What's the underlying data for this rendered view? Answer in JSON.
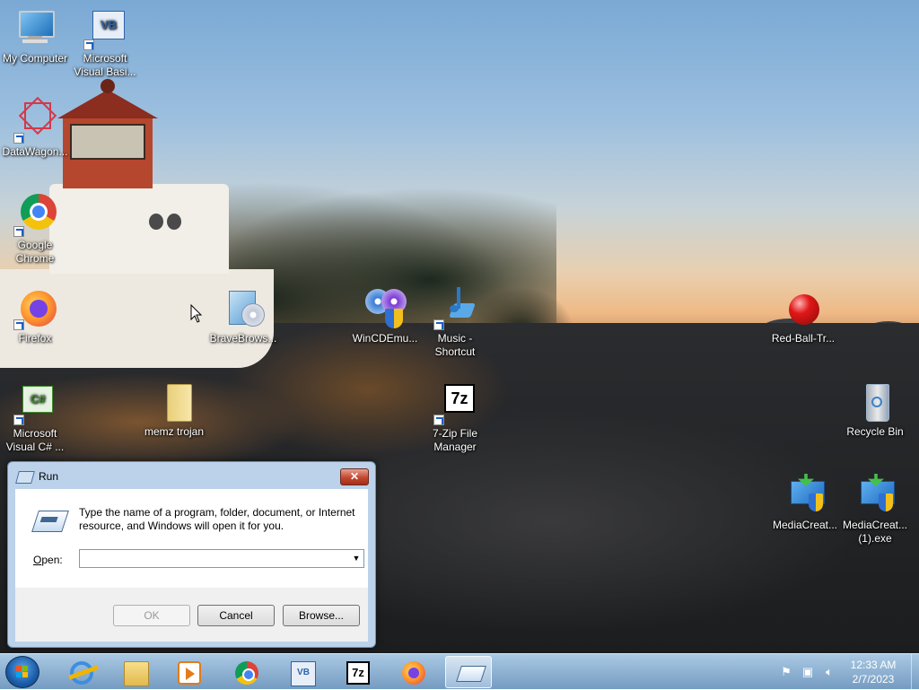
{
  "desktop": {
    "icons": {
      "my_computer": "My Computer",
      "visual_basic": "Microsoft Visual Basi...",
      "datawagon": "DataWagon...",
      "chrome": "Google Chrome",
      "firefox": "Firefox",
      "brave": "BraveBrows...",
      "wincdemu": "WinCDEmu...",
      "music": "Music - Shortcut",
      "red_ball": "Red-Ball-Tr...",
      "visual_csharp": "Microsoft Visual C# ...",
      "memz": "memz trojan",
      "sevenzip": "7-Zip File Manager",
      "recycle_bin": "Recycle Bin",
      "mediacreation1": "MediaCreat...",
      "mediacreation2": "MediaCreat... (1).exe"
    },
    "icon_names": {
      "my_computer": "computer-icon",
      "visual_basic": "visual-basic-icon",
      "datawagon": "datawagon-icon",
      "chrome": "chrome-icon",
      "firefox": "firefox-icon",
      "brave": "installer-icon",
      "wincdemu": "disc-icon",
      "music": "music-note-icon",
      "red_ball": "red-ball-icon",
      "visual_csharp": "visual-csharp-icon",
      "memz": "folder-icon",
      "sevenzip": "7zip-icon",
      "recycle_bin": "recycle-bin-icon",
      "mediacreation": "shield-setup-icon"
    }
  },
  "run_dialog": {
    "title": "Run",
    "description": "Type the name of a program, folder, document, or Internet resource, and Windows will open it for you.",
    "open_label_prefix": "O",
    "open_label_rest": "pen:",
    "input_value": "",
    "ok_label": "OK",
    "cancel_label": "Cancel",
    "browse_label": "Browse...",
    "close_label": "✕"
  },
  "taskbar": {
    "pinned": [
      "internet-explorer-icon",
      "explorer-folder-icon",
      "media-player-icon",
      "chrome-icon",
      "visual-basic-icon",
      "7zip-icon",
      "firefox-icon",
      "run-icon"
    ],
    "active": "run-icon",
    "clock_time": "12:33 AM",
    "clock_date": "2/7/2023",
    "sevenzip_label": "7z",
    "vb_label": "VB"
  },
  "colors": {
    "accent": "#1b5ca8",
    "close_button": "#c4472f",
    "dialog_frame": "#bcd2ea"
  }
}
